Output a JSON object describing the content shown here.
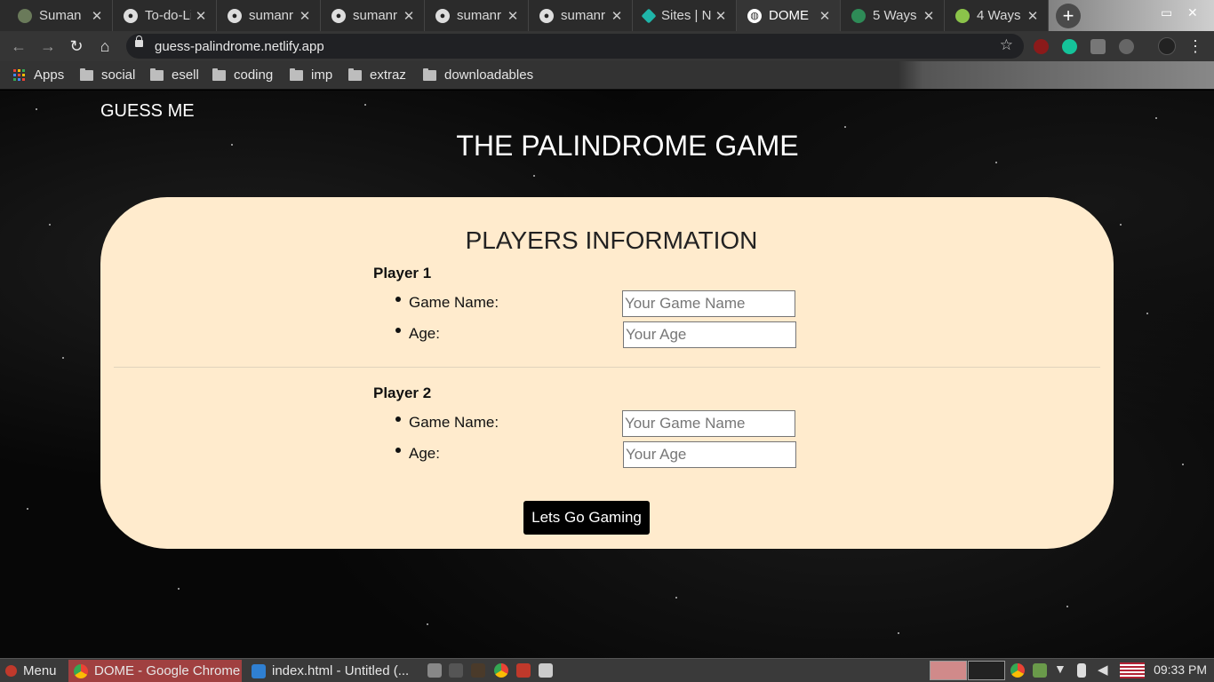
{
  "browser": {
    "tabs": [
      {
        "title": "Suman",
        "icon": "person-icon"
      },
      {
        "title": "To-do-Li",
        "icon": "github-icon"
      },
      {
        "title": "sumanr",
        "icon": "github-icon"
      },
      {
        "title": "sumanr",
        "icon": "github-icon"
      },
      {
        "title": "sumanr",
        "icon": "github-icon"
      },
      {
        "title": "sumanr",
        "icon": "github-icon"
      },
      {
        "title": "Sites | N",
        "icon": "netlify-icon"
      },
      {
        "title": "DOME",
        "icon": "globe-icon"
      },
      {
        "title": "5 Ways",
        "icon": "site-icon"
      },
      {
        "title": "4 Ways",
        "icon": "site-icon"
      }
    ],
    "close_glyph": "✕",
    "new_tab": "+",
    "url": "guess-palindrome.netlify.app",
    "bookmarks": {
      "apps": "Apps",
      "folders": [
        "social",
        "esell",
        "coding",
        "imp",
        "extraz",
        "downloadables"
      ]
    }
  },
  "page": {
    "brand": "GUESS ME",
    "heading": "THE PALINDROME GAME",
    "form": {
      "title": "PLAYERS INFORMATION",
      "players": [
        {
          "label": "Player 1",
          "game_name_label": "Game Name:",
          "game_name_placeholder": "Your Game Name",
          "age_label": "Age:",
          "age_placeholder": "Your Age"
        },
        {
          "label": "Player 2",
          "game_name_label": "Game Name:",
          "game_name_placeholder": "Your Game Name",
          "age_label": "Age:",
          "age_placeholder": "Your Age"
        }
      ],
      "submit_label": "Lets Go Gaming"
    },
    "colors": {
      "card": "#ffebcd",
      "button": "#000000"
    }
  },
  "taskbar": {
    "menu": "Menu",
    "tasks": [
      "DOME - Google Chrome",
      "index.html - Untitled (..."
    ],
    "clock": "09:33 PM"
  }
}
